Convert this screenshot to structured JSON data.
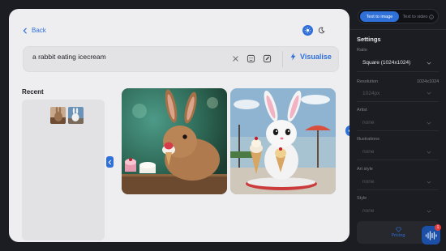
{
  "nav": {
    "back_label": "Back"
  },
  "prompt": {
    "value": "a rabbit eating icecream",
    "visualise_label": "Visualise"
  },
  "recent": {
    "label": "Recent"
  },
  "sidebar": {
    "tabs": [
      {
        "label": "Text to image",
        "active": true
      },
      {
        "label": "Text to video",
        "active": false
      }
    ],
    "settings_title": "Settings",
    "fields": {
      "ratio": {
        "label": "Ratio",
        "value": "Square (1024x1024)"
      },
      "resolution": {
        "label": "Resolution",
        "side_value": "1024x1024",
        "value": "1024px"
      },
      "artist": {
        "label": "Artist",
        "value": "none"
      },
      "illustrations": {
        "label": "Illustrations",
        "value": "none"
      },
      "art_style": {
        "label": "Art style",
        "value": "none"
      },
      "style": {
        "label": "Style",
        "value": "none"
      }
    },
    "pricing_label": "Pricing"
  },
  "voice_widget": {
    "badge": "1"
  },
  "colors": {
    "accent": "#2f6fd8",
    "panel": "#eeeef0",
    "background": "#1c1d22"
  }
}
